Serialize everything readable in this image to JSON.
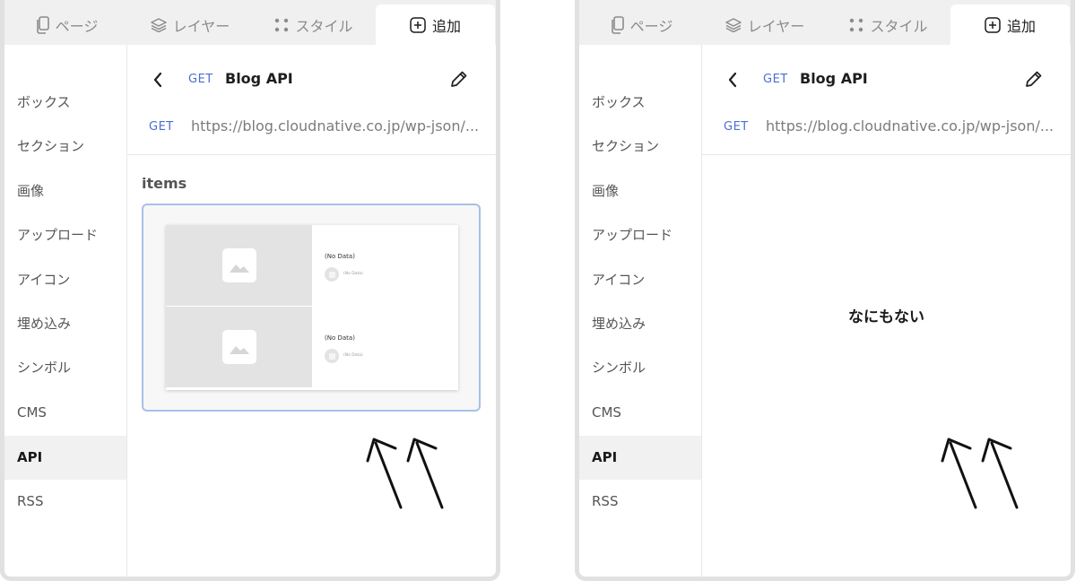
{
  "tabs": [
    {
      "label": "ページ",
      "icon": "page-icon"
    },
    {
      "label": "レイヤー",
      "icon": "layers-icon"
    },
    {
      "label": "スタイル",
      "icon": "style-icon"
    },
    {
      "label": "追加",
      "icon": "add-icon",
      "active": true
    }
  ],
  "sidebar": {
    "items": [
      {
        "label": "ボックス"
      },
      {
        "label": "セクション"
      },
      {
        "label": "画像"
      },
      {
        "label": "アップロード"
      },
      {
        "label": "アイコン"
      },
      {
        "label": "埋め込み"
      },
      {
        "label": "シンボル"
      },
      {
        "label": "CMS"
      },
      {
        "label": "API",
        "selected": true
      },
      {
        "label": "RSS"
      }
    ]
  },
  "api": {
    "method": "GET",
    "title": "Blog API",
    "url": "https://blog.cloudnative.co.jp/wp-json/..."
  },
  "left_panel": {
    "section_label": "items",
    "preview": {
      "items": [
        {
          "title": "(No Data)",
          "subtitle": "(No Data)"
        },
        {
          "title": "(No Data)",
          "subtitle": "(No Data)"
        }
      ]
    }
  },
  "right_panel": {
    "empty_message": "なにもない"
  },
  "colors": {
    "accent": "#4a6fd1",
    "selection_border": "#a9bfe9",
    "tabbar_bg": "#f0f0f0",
    "panel_border": "#e1e1e1"
  }
}
